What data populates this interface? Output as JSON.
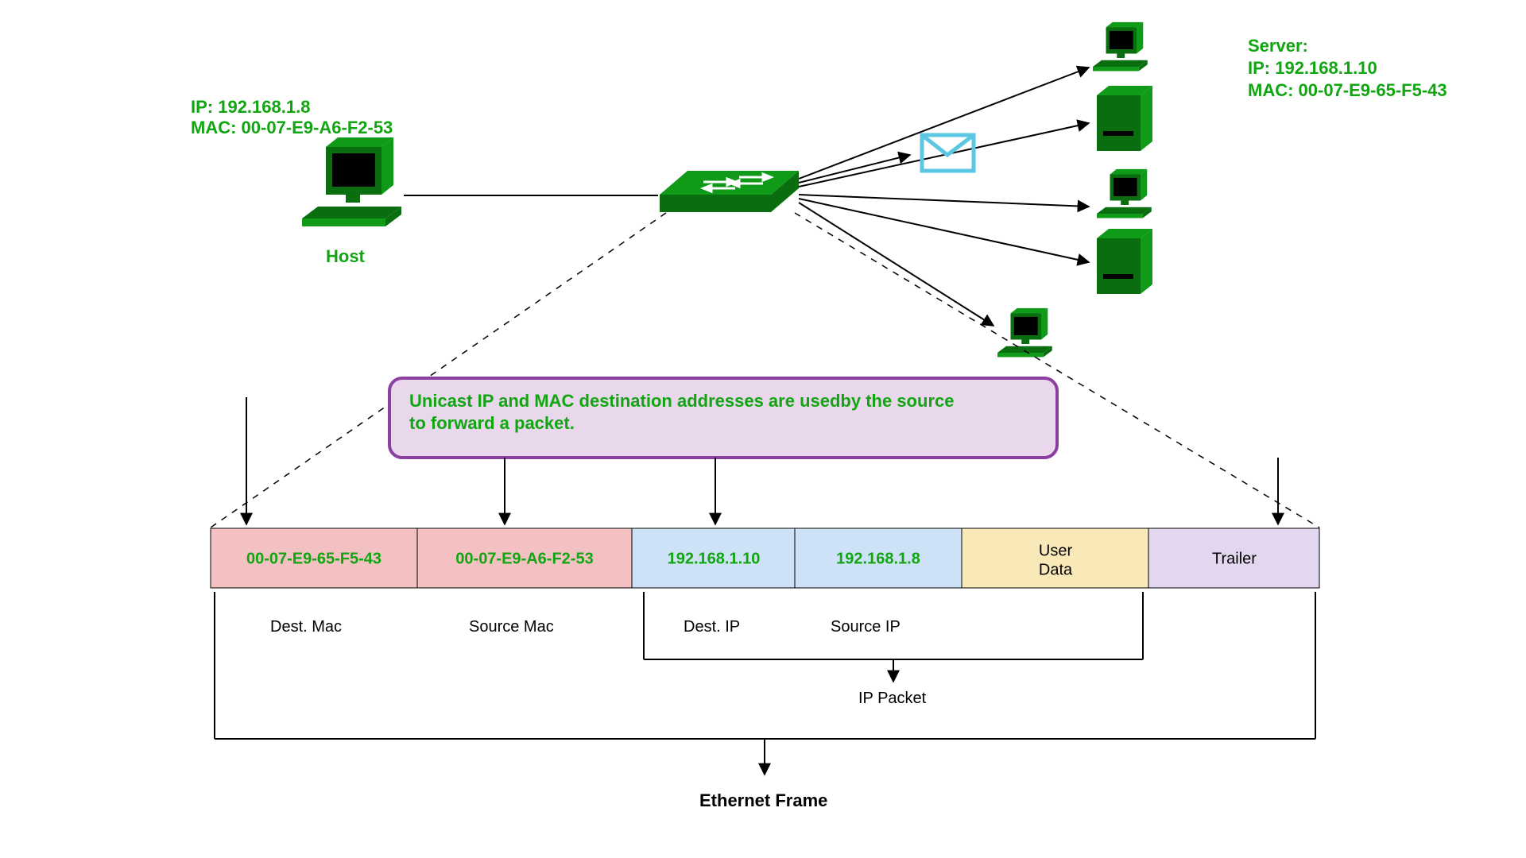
{
  "host": {
    "ip_line": "IP: 192.168.1.8",
    "mac_line": "MAC: 00-07-E9-A6-F2-53",
    "label": "Host"
  },
  "server": {
    "title": "Server:",
    "ip_line": "IP: 192.168.1.10",
    "mac_line": "MAC: 00-07-E9-65-F5-43"
  },
  "callout": {
    "line1": "Unicast IP and MAC destination addresses are usedby the source",
    "line2": "to forward a packet."
  },
  "frame": {
    "segments": {
      "dest_mac": {
        "value": "00-07-E9-65-F5-43",
        "caption": "Dest. Mac"
      },
      "source_mac": {
        "value": "00-07-E9-A6-F2-53",
        "caption": "Source Mac"
      },
      "dest_ip": {
        "value": "192.168.1.10",
        "caption": "Dest. IP"
      },
      "source_ip": {
        "value": "192.168.1.8",
        "caption": "Source IP"
      },
      "user_data": {
        "value_line1": "User",
        "value_line2": "Data"
      },
      "trailer": {
        "value": "Trailer"
      }
    },
    "ip_packet_label": "IP Packet",
    "ethernet_frame_label": "Ethernet Frame"
  },
  "colors": {
    "device": "#0f9a18",
    "device_dark": "#0a6e10",
    "red_seg": "#f3c1c1",
    "blue_seg": "#cde2f6",
    "yellow_seg": "#fae9b8",
    "purple_seg": "#e3d6ef",
    "callout_fill": "#e9d7ec",
    "callout_stroke": "#8b3fa1",
    "envelope": "#5bc7e2"
  }
}
